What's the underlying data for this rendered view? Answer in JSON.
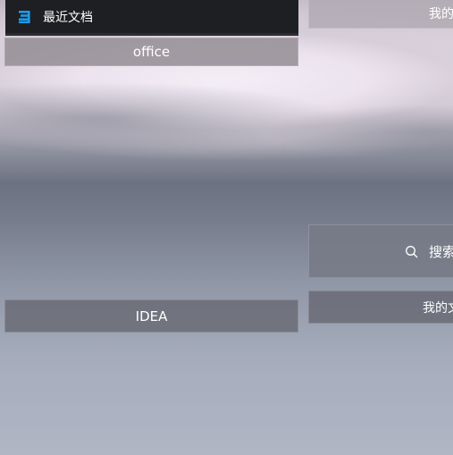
{
  "recent_docs": {
    "label": "最近文档",
    "icon": "document-stack-icon",
    "icon_color": "#1e9be9"
  },
  "tiles": {
    "office": "office",
    "idea": "IDEA",
    "mine_top": "我的",
    "search": "搜索",
    "search_icon": "search-icon",
    "mine_doc": "我的文"
  }
}
